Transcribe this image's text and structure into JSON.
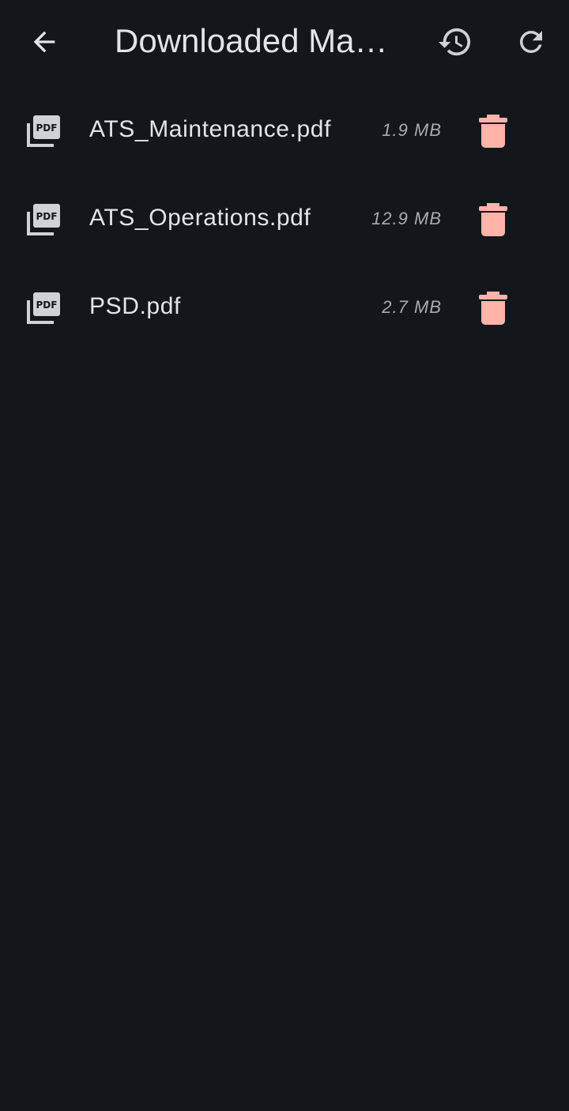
{
  "header": {
    "title": "Downloaded Ma…",
    "back_icon": "arrow-back-icon",
    "history_icon": "history-icon",
    "refresh_icon": "refresh-icon"
  },
  "files": [
    {
      "name": "ATS_Maintenance.pdf",
      "size": "1.9 MB",
      "icon": "pdf-icon",
      "action_icon": "delete-icon"
    },
    {
      "name": "ATS_Operations.pdf",
      "size": "12.9 MB",
      "icon": "pdf-icon",
      "action_icon": "delete-icon"
    },
    {
      "name": "PSD.pdf",
      "size": "2.7 MB",
      "icon": "pdf-icon",
      "action_icon": "delete-icon"
    }
  ],
  "colors": {
    "background": "#13161b",
    "text": "#e3e4e8",
    "secondary_text": "#a9abb1",
    "delete": "#ffb3a9",
    "icon": "#cfd1d6"
  }
}
